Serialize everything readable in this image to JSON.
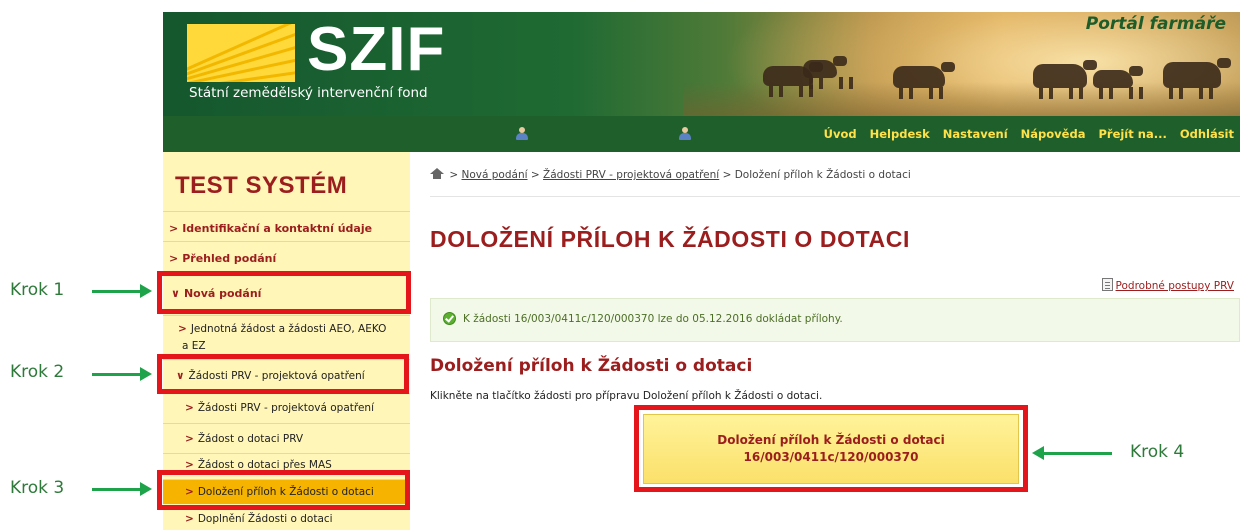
{
  "header": {
    "logo_name": "SZIF",
    "logo_sub": "Státní zemědělský intervenční fond",
    "portal_title": "Portál farmáře"
  },
  "topnav": {
    "items": [
      "Úvod",
      "Helpdesk",
      "Nastavení",
      "Nápověda",
      "Přejít na...",
      "Odhlásit"
    ]
  },
  "sidebar": {
    "title": "TEST SYSTÉM",
    "items": [
      {
        "label": "Identifikační a kontaktní údaje",
        "chevron": ">"
      },
      {
        "label": "Přehled podání",
        "chevron": ">"
      },
      {
        "label": "Nová podání",
        "chevron": "∨"
      },
      {
        "label": "Jednotná žádost a žádosti AEO, AEKO",
        "label2": "a EZ",
        "chevron": ">"
      },
      {
        "label": "Žádosti PRV - projektová opatření",
        "chevron": "∨"
      },
      {
        "label": "Žádosti PRV - projektová opatření",
        "chevron": ">"
      },
      {
        "label": "Žádost o dotaci PRV",
        "chevron": ">"
      },
      {
        "label": "Žádost o dotaci přes MAS",
        "chevron": ">"
      },
      {
        "label": "Doložení příloh k Žádosti o dotaci",
        "chevron": ">"
      },
      {
        "label": "Doplnění Žádosti o dotaci",
        "chevron": ">"
      }
    ]
  },
  "annotations": {
    "krok1": "Krok 1",
    "krok2": "Krok 2",
    "krok3": "Krok 3",
    "krok4": "Krok 4"
  },
  "breadcrumb": {
    "sep": ">",
    "link1": "Nová podání",
    "link2": "Žádosti PRV - projektová opatření",
    "current": "Doložení příloh k Žádosti o dotaci"
  },
  "main": {
    "page_title": "DOLOŽENÍ PŘÍLOH K ŽÁDOSTI O DOTACI",
    "help_link": "Podrobné postupy PRV",
    "info_text": "K žádosti 16/003/0411c/120/000370 lze do 05.12.2016 dokládat přílohy.",
    "section_title": "Doložení příloh k Žádosti o dotaci",
    "instruction": "Klikněte na tlačítko žádosti pro přípravu Doložení příloh k Žádosti o dotaci.",
    "button_line1": "Doložení příloh k Žádosti o dotaci",
    "button_line2": "16/003/0411c/120/000370"
  },
  "colors": {
    "header_green": "#1f5f2c",
    "nav_text_yellow": "#ffe24a",
    "sidebar_bg": "#fff6b8",
    "sidebar_active": "#f6b400",
    "title_red": "#9b1d1d",
    "highlight_red": "#e4151b",
    "arrow_green": "#1ea34a"
  }
}
